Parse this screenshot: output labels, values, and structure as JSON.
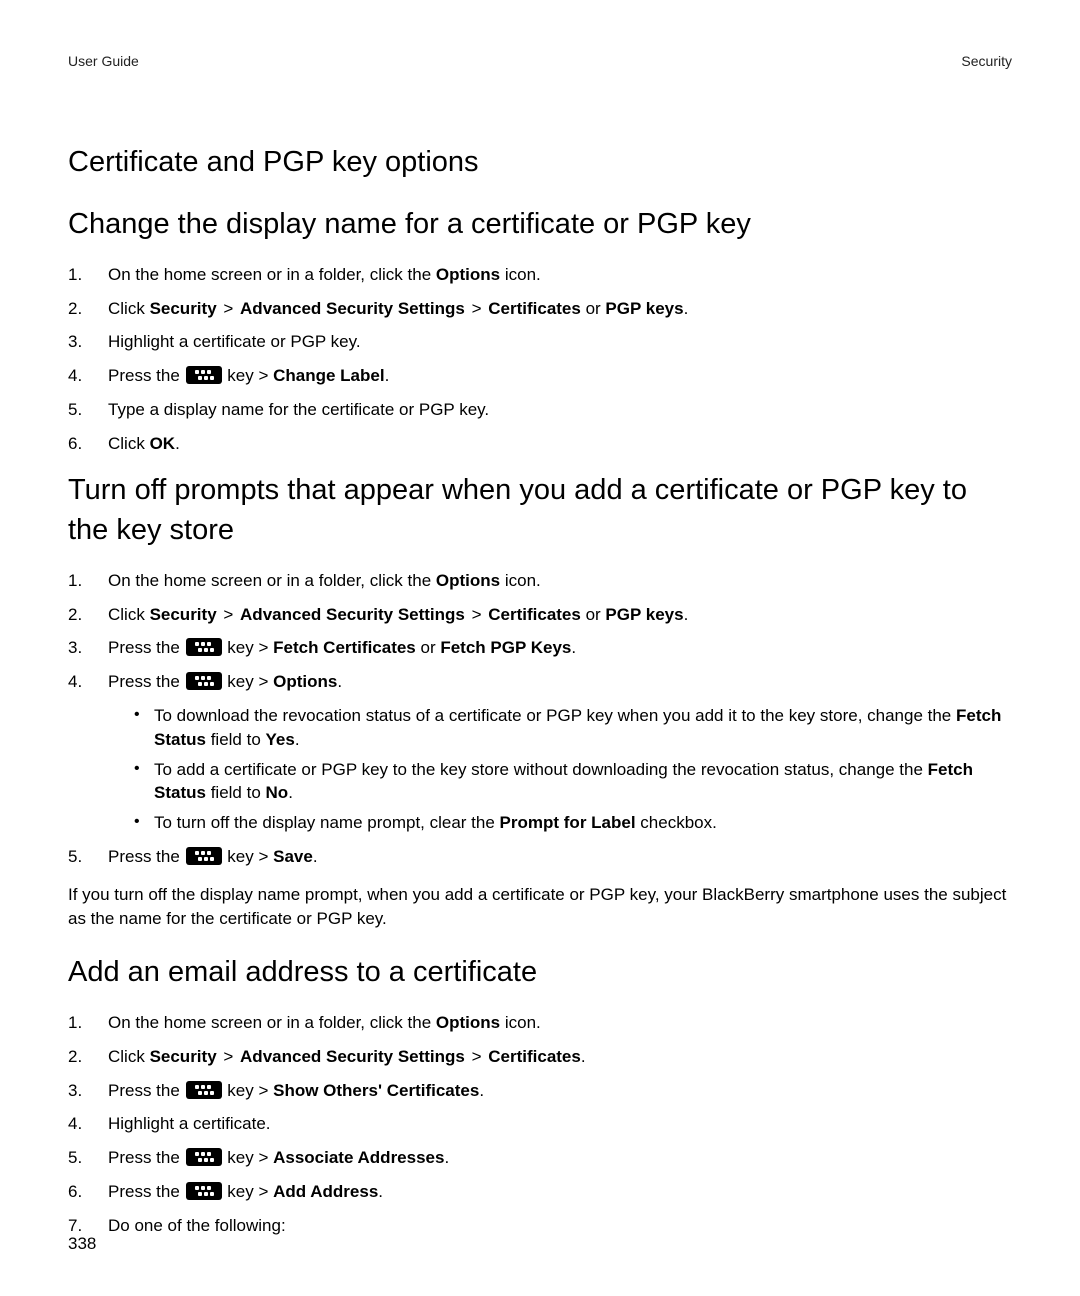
{
  "header": {
    "left": "User Guide",
    "right": "Security"
  },
  "h1": "Certificate and PGP key options",
  "sectionA": {
    "title": "Change the display name for a certificate or PGP key",
    "steps": [
      {
        "pre": "On the home screen or in a folder, click the ",
        "b": "Options",
        "post": " icon."
      },
      {
        "pre": "Click ",
        "b1": "Security",
        "g1": " > ",
        "b2": "Advanced Security Settings",
        "g2": " > ",
        "b3": "Certificates",
        "or": " or ",
        "b4": "PGP keys",
        "post": "."
      },
      {
        "text": "Highlight a certificate or PGP key."
      },
      {
        "press_pre": "Press the ",
        "press_post": " key > ",
        "b": "Change Label",
        "end": "."
      },
      {
        "text": "Type a display name for the certificate or PGP key."
      },
      {
        "pre": "Click ",
        "b": "OK",
        "post": "."
      }
    ]
  },
  "sectionB": {
    "title": "Turn off prompts that appear when you add a certificate or PGP key to the key store",
    "steps": [
      {
        "pre": "On the home screen or in a folder, click the ",
        "b": "Options",
        "post": " icon."
      },
      {
        "pre": "Click ",
        "b1": "Security",
        "g1": " > ",
        "b2": "Advanced Security Settings",
        "g2": " > ",
        "b3": "Certificates",
        "or": " or ",
        "b4": "PGP keys",
        "post": "."
      },
      {
        "press_pre": "Press the ",
        "press_post": " key > ",
        "b1": "Fetch Certificates",
        "or": " or ",
        "b2": "Fetch PGP Keys",
        "end": "."
      },
      {
        "press_pre": "Press the ",
        "press_post": " key > ",
        "b": "Options",
        "end": ".",
        "bullets": [
          {
            "pre": "To download the revocation status of a certificate or PGP key when you add it to the key store, change the ",
            "b": "Fetch Status",
            "mid": " field to ",
            "b2": "Yes",
            "post": "."
          },
          {
            "pre": "To add a certificate or PGP key to the key store without downloading the revocation status, change the ",
            "b": "Fetch Status",
            "mid": " field to ",
            "b2": "No",
            "post": "."
          },
          {
            "pre": "To turn off the display name prompt, clear the ",
            "b": "Prompt for Label",
            "post": " checkbox."
          }
        ]
      },
      {
        "press_pre": "Press the ",
        "press_post": " key > ",
        "b": "Save",
        "end": "."
      }
    ],
    "after": "If you turn off the display name prompt, when you add a certificate or PGP key, your BlackBerry smartphone uses the subject as the name for the certificate or PGP key."
  },
  "sectionC": {
    "title": "Add an email address to a certificate",
    "steps": [
      {
        "pre": "On the home screen or in a folder, click the ",
        "b": "Options",
        "post": " icon."
      },
      {
        "pre": "Click ",
        "b1": "Security",
        "g1": " > ",
        "b2": "Advanced Security Settings",
        "g2": " > ",
        "b3": "Certificates",
        "post": "."
      },
      {
        "press_pre": "Press the ",
        "press_post": " key > ",
        "b": "Show Others' Certificates",
        "end": "."
      },
      {
        "text": "Highlight a certificate."
      },
      {
        "press_pre": "Press the ",
        "press_post": " key > ",
        "b": "Associate Addresses",
        "end": "."
      },
      {
        "press_pre": "Press the ",
        "press_post": " key > ",
        "b": "Add Address",
        "end": "."
      },
      {
        "text": "Do one of the following:"
      }
    ]
  },
  "pageNumber": "338"
}
